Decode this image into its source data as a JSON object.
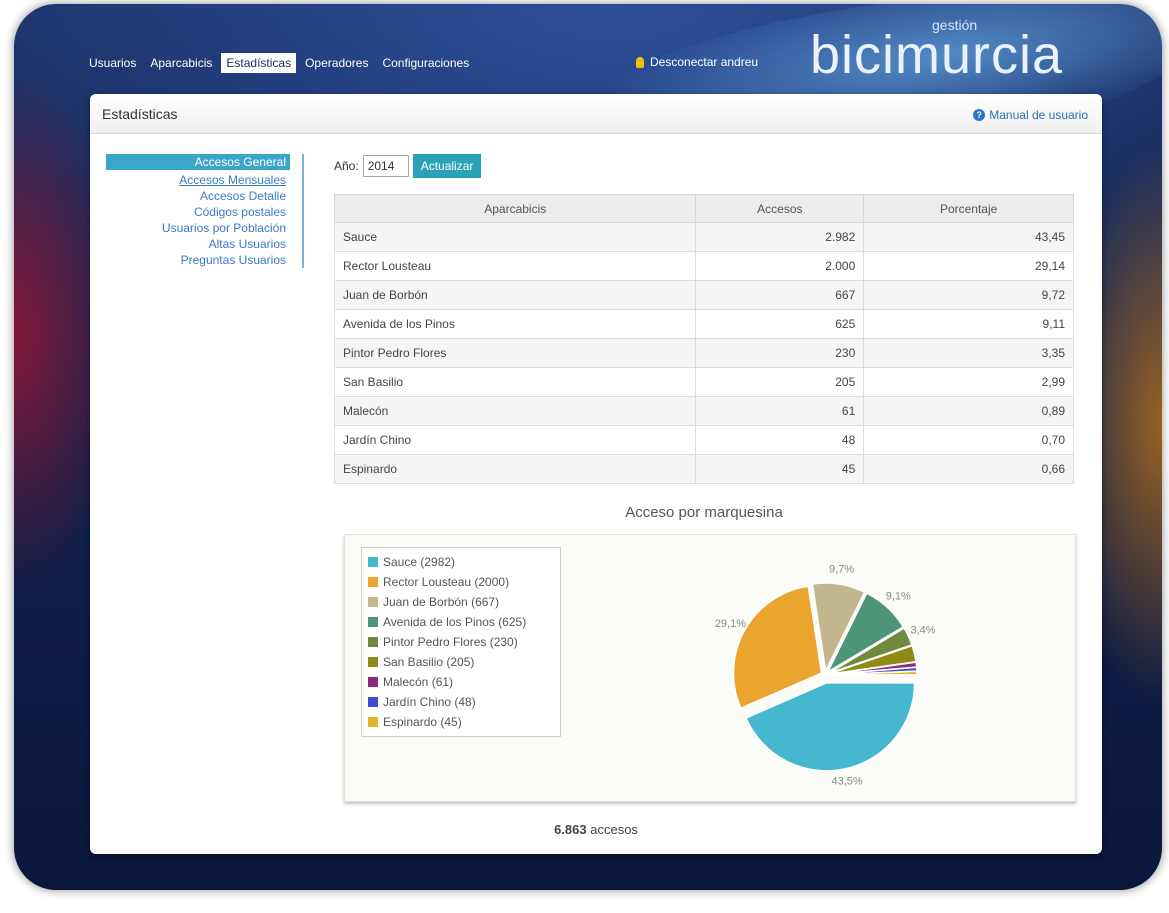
{
  "nav": {
    "items": [
      {
        "label": "Usuarios",
        "active": false
      },
      {
        "label": "Aparcabicis",
        "active": false
      },
      {
        "label": "Estadísticas",
        "active": true
      },
      {
        "label": "Operadores",
        "active": false
      },
      {
        "label": "Configuraciones",
        "active": false
      }
    ],
    "disconnect_label": "Desconectar andreu"
  },
  "logo": {
    "small": "gestión",
    "big": "bicimurcia"
  },
  "panel": {
    "title": "Estadísticas",
    "manual_label": "Manual de usuario"
  },
  "sidebar": {
    "items": [
      {
        "label": "Accesos General",
        "active": true
      },
      {
        "label": "Accesos Mensuales",
        "active": false
      },
      {
        "label": "Accesos Detalle",
        "active": false
      },
      {
        "label": "Códigos postales",
        "active": false
      },
      {
        "label": "Usuarios por Población",
        "active": false
      },
      {
        "label": "Altas Usuarios",
        "active": false
      },
      {
        "label": "Preguntas Usuarios",
        "active": false
      }
    ]
  },
  "filter": {
    "year_label": "Año:",
    "year_value": "2014",
    "update_label": "Actualizar"
  },
  "table": {
    "headers": [
      "Aparcabicis",
      "Accesos",
      "Porcentaje"
    ],
    "rows": [
      [
        "Sauce",
        "2.982",
        "43,45"
      ],
      [
        "Rector Lousteau",
        "2.000",
        "29,14"
      ],
      [
        "Juan de Borbón",
        "667",
        "9,72"
      ],
      [
        "Avenida de los Pinos",
        "625",
        "9,11"
      ],
      [
        "Pintor Pedro Flores",
        "230",
        "3,35"
      ],
      [
        "San Basilio",
        "205",
        "2,99"
      ],
      [
        "Malecón",
        "61",
        "0,89"
      ],
      [
        "Jardín Chino",
        "48",
        "0,70"
      ],
      [
        "Espinardo",
        "45",
        "0,66"
      ]
    ]
  },
  "chart_data": {
    "type": "pie",
    "title": "Acceso por marquesina",
    "categories": [
      "Sauce (2982)",
      "Rector Lousteau (2000)",
      "Juan de Borbón (667)",
      "Avenida de los Pinos (625)",
      "Pintor Pedro Flores (230)",
      "San Basilio (205)",
      "Malecón (61)",
      "Jardín Chino (48)",
      "Espinardo (45)"
    ],
    "values": [
      2982,
      2000,
      667,
      625,
      230,
      205,
      61,
      48,
      45
    ],
    "colors": [
      "#45b7cf",
      "#e9a52e",
      "#c4b68e",
      "#4e9478",
      "#6f8a3c",
      "#8f8a14",
      "#8c2a7f",
      "#3f4bd0",
      "#e0b52a"
    ],
    "slice_labels": [
      "43,5%",
      "29,1%",
      "9,7%",
      "9,1%",
      "3,4%",
      "",
      "",
      "",
      ""
    ],
    "legend": "left"
  },
  "total": {
    "value": "6.863",
    "suffix": "accesos"
  }
}
